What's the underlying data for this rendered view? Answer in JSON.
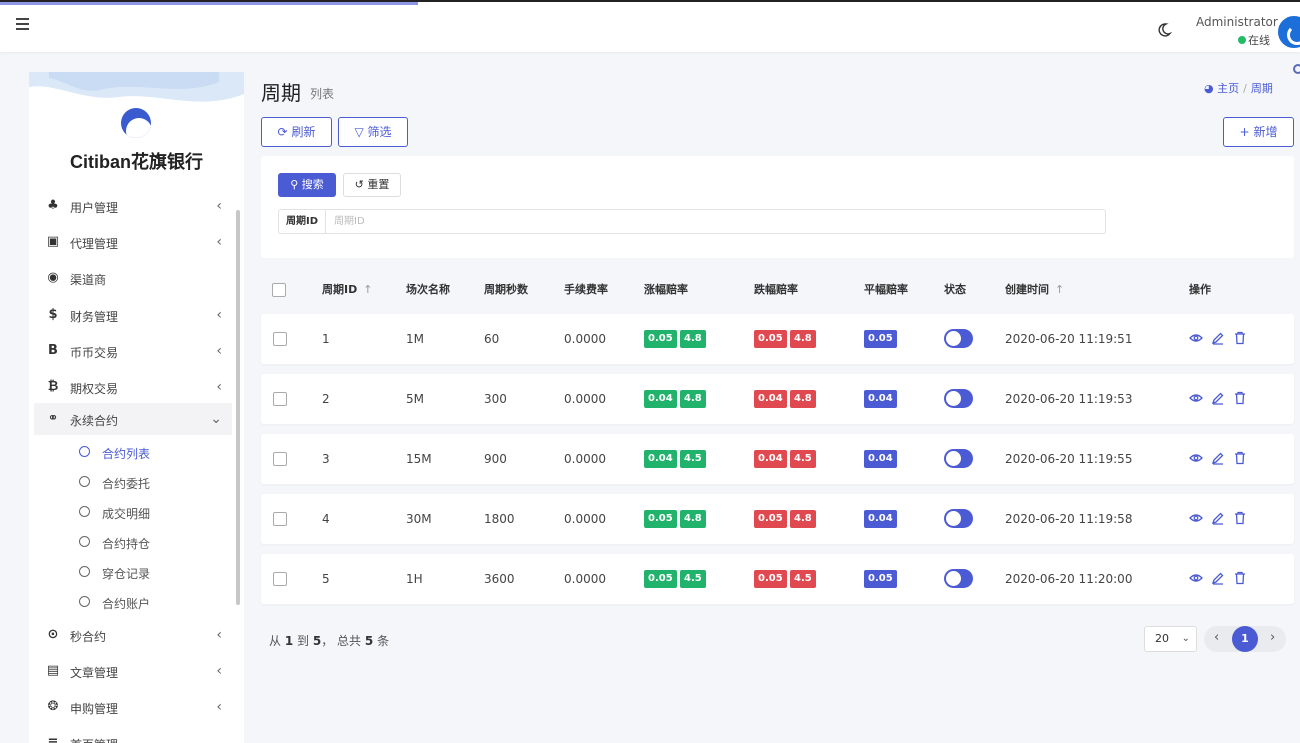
{
  "header": {
    "user_name": "Administrator",
    "user_status": "在线"
  },
  "sidebar": {
    "brand": "Citiban花旗银行",
    "items": [
      {
        "label": "用户管理",
        "icon": "users-icon",
        "glyph": "♣"
      },
      {
        "label": "代理管理",
        "icon": "id-card-icon",
        "glyph": "▣"
      },
      {
        "label": "渠道商",
        "icon": "user-circle-icon",
        "glyph": "◉"
      },
      {
        "label": "财务管理",
        "icon": "dollar-icon",
        "glyph": "$"
      },
      {
        "label": "币币交易",
        "icon": "bold-b-icon",
        "glyph": "B"
      },
      {
        "label": "期权交易",
        "icon": "bitcoin-icon",
        "glyph": "₿"
      },
      {
        "label": "永续合约",
        "icon": "link-icon",
        "glyph": "⚭"
      },
      {
        "label": "秒合约",
        "icon": "dot-circle-icon",
        "glyph": "⊙"
      },
      {
        "label": "文章管理",
        "icon": "newspaper-icon",
        "glyph": "▤"
      },
      {
        "label": "申购管理",
        "icon": "life-ring-icon",
        "glyph": "❂"
      },
      {
        "label": "首页管理",
        "icon": "bars-icon",
        "glyph": "≡"
      }
    ],
    "subitems": [
      "合约列表",
      "合约委托",
      "成交明细",
      "合约持仓",
      "穿仓记录",
      "合约账户"
    ]
  },
  "page": {
    "title": "周期",
    "subtitle": "列表",
    "breadcrumb_home": "主页",
    "breadcrumb_current": "周期"
  },
  "toolbar": {
    "refresh": "刷新",
    "filter": "筛选",
    "add": "新增"
  },
  "filter": {
    "search_button": "搜索",
    "reset_button": "重置",
    "field_label": "周期ID",
    "field_placeholder": "周期ID",
    "field_value": ""
  },
  "table": {
    "columns": [
      "周期ID",
      "场次名称",
      "周期秒数",
      "手续费率",
      "涨幅赔率",
      "跌幅赔率",
      "平幅赔率",
      "状态",
      "创建时间",
      "操作"
    ],
    "sort_glyph": "↑",
    "rows": [
      {
        "id": "1",
        "name": "1M",
        "seconds": "60",
        "fee": "0.0000",
        "up": [
          "0.05",
          "4.8"
        ],
        "down": [
          "0.05",
          "4.8"
        ],
        "flat": "0.05",
        "status_on": true,
        "created": "2020-06-20 11:19:51"
      },
      {
        "id": "2",
        "name": "5M",
        "seconds": "300",
        "fee": "0.0000",
        "up": [
          "0.04",
          "4.8"
        ],
        "down": [
          "0.04",
          "4.8"
        ],
        "flat": "0.04",
        "status_on": true,
        "created": "2020-06-20 11:19:53"
      },
      {
        "id": "3",
        "name": "15M",
        "seconds": "900",
        "fee": "0.0000",
        "up": [
          "0.04",
          "4.5"
        ],
        "down": [
          "0.04",
          "4.5"
        ],
        "flat": "0.04",
        "status_on": true,
        "created": "2020-06-20 11:19:55"
      },
      {
        "id": "4",
        "name": "30M",
        "seconds": "1800",
        "fee": "0.0000",
        "up": [
          "0.05",
          "4.8"
        ],
        "down": [
          "0.05",
          "4.8"
        ],
        "flat": "0.04",
        "status_on": true,
        "created": "2020-06-20 11:19:58"
      },
      {
        "id": "5",
        "name": "1H",
        "seconds": "3600",
        "fee": "0.0000",
        "up": [
          "0.05",
          "4.5"
        ],
        "down": [
          "0.05",
          "4.5"
        ],
        "flat": "0.05",
        "status_on": true,
        "created": "2020-06-20 11:20:00"
      }
    ]
  },
  "pagination": {
    "from_prefix": "从",
    "from": "1",
    "to_prefix": "到",
    "to": "5",
    "total_prefix": "， 总共",
    "total": "5",
    "total_suffix": "条",
    "page_size": "20",
    "current_page": "1"
  },
  "colors": {
    "accent": "#4a5bd4",
    "green": "#21b36b",
    "red": "#e0494f",
    "blue_badge": "#4a5bd4"
  }
}
